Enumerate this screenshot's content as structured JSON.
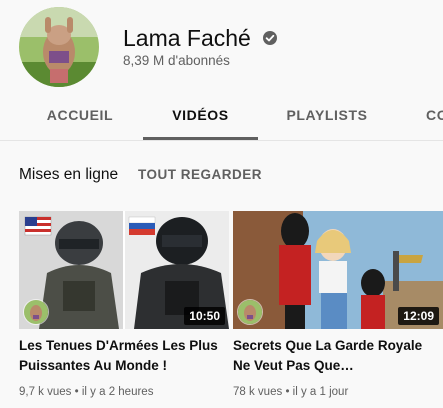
{
  "channel": {
    "name": "Lama Faché",
    "subscribers": "8,39 M d'abonnés"
  },
  "tabs": [
    {
      "label": "ACCUEIL"
    },
    {
      "label": "VIDÉOS"
    },
    {
      "label": "PLAYLISTS"
    },
    {
      "label": "CO"
    }
  ],
  "active_tab": "VIDÉOS",
  "section": {
    "title": "Mises en ligne",
    "see_all": "TOUT REGARDER"
  },
  "videos": [
    {
      "title": "Les Tenues D'Armées Les Plus Puissantes Au Monde !",
      "duration": "10:50",
      "views": "9,7 k vues",
      "age": "il y a 2 heures"
    },
    {
      "title": "Secrets Que La Garde Royale Ne Veut Pas Que…",
      "duration": "12:09",
      "views": "78 k vues",
      "age": "il y a 1 jour"
    }
  ],
  "colors": {
    "background": "#f9f9f9",
    "text_primary": "#0f0f0f",
    "text_secondary": "#606060"
  }
}
